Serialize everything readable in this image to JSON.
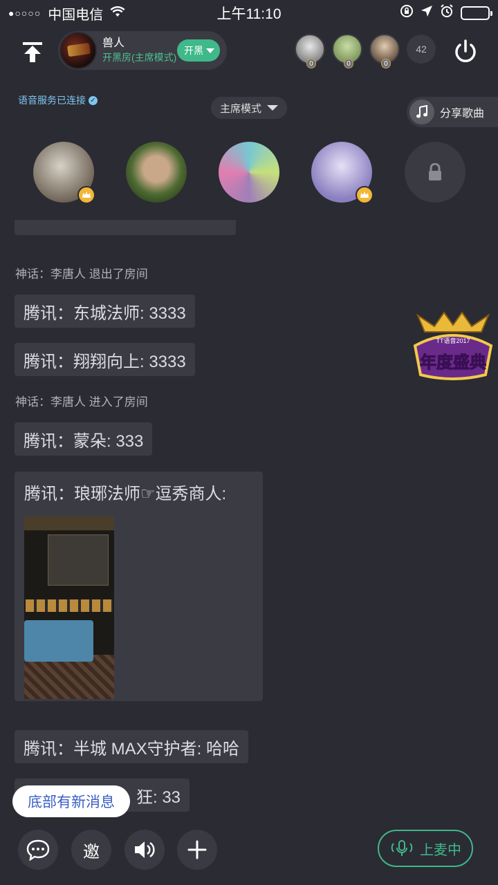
{
  "status_bar": {
    "carrier": "中国电信",
    "signal": "●○○○○",
    "time": "上午11:10"
  },
  "header": {
    "room_name": "兽人",
    "room_mode": "开黑房(主席模式)",
    "room_tag": "开黑",
    "online_count": "42",
    "online_users": [
      {
        "count": "0",
        "color": "#d8d8d8"
      },
      {
        "count": "0",
        "color": "#a9c48e"
      },
      {
        "count": "0",
        "color": "#c9b29a"
      }
    ]
  },
  "sub_header": {
    "voice_status": "语音服务已连接",
    "mode_select": "主席模式",
    "share_song": "分享歌曲"
  },
  "seats": [
    {
      "name": "seat-1",
      "crown": true,
      "colors": [
        "#c7c2b8",
        "#6b5f52"
      ]
    },
    {
      "name": "seat-2",
      "crown": false,
      "colors": [
        "#6d8a4a",
        "#3f5a2a"
      ]
    },
    {
      "name": "seat-3",
      "crown": false,
      "colors": [
        "#77c7d3",
        "#a07fb8"
      ]
    },
    {
      "name": "seat-4",
      "crown": true,
      "colors": [
        "#b8aedb",
        "#6a5f98"
      ]
    },
    {
      "name": "seat-5-locked",
      "crown": false,
      "locked": true
    }
  ],
  "chat": {
    "messages": [
      {
        "type": "sys",
        "text": "神话：李唐人 退出了房间"
      },
      {
        "type": "bubble",
        "text": "腾讯：东城法师: 3333"
      },
      {
        "type": "bubble",
        "text": "腾讯：翔翔向上: 3333"
      },
      {
        "type": "sys",
        "text": "神话：李唐人 进入了房间"
      },
      {
        "type": "bubble",
        "text": "腾讯：蒙朵: 333"
      },
      {
        "type": "image",
        "text": "腾讯：琅琊法师☞逗秀商人:"
      },
      {
        "type": "bubble",
        "text": "腾讯：半城  MAX守护者: 哈哈"
      },
      {
        "type": "bubble",
        "text": "狂: 33"
      }
    ],
    "new_message_hint": "底部有新消息"
  },
  "bottom_bar": {
    "invite_label": "邀",
    "mic_label": "上麦中"
  },
  "badge": {
    "line1": "TT语音2017",
    "line2": "年度盛典"
  },
  "colors": {
    "background": "#2b2b33",
    "accent_green": "#3fb98a",
    "voice_blue": "#7fc7f0",
    "crown_gold": "#f2b736"
  }
}
